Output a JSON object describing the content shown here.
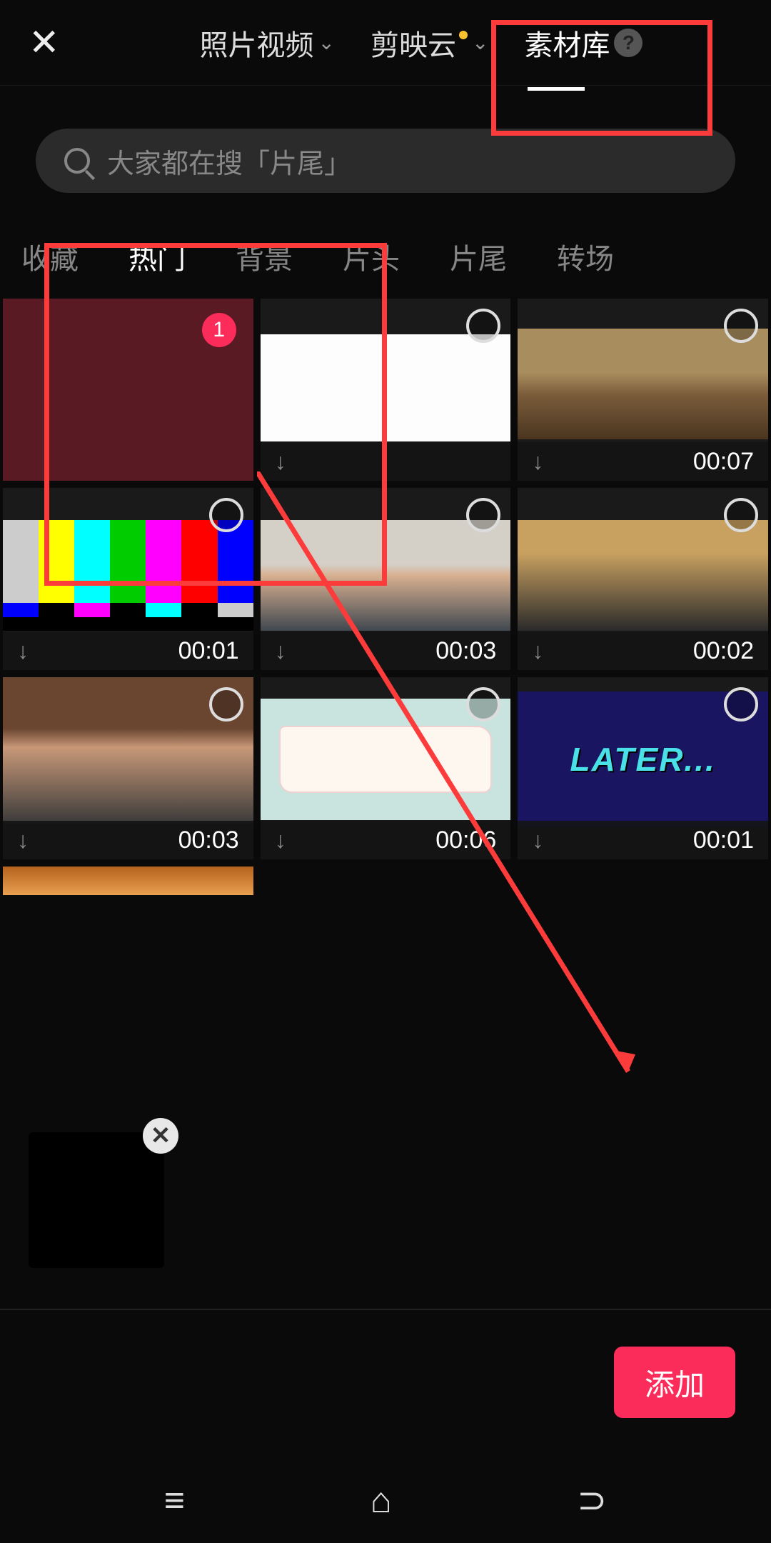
{
  "header": {
    "tabs": [
      {
        "label": "照片视频",
        "has_chevron": true
      },
      {
        "label": "剪映云",
        "has_chevron": true,
        "has_dot": true
      },
      {
        "label": "素材库",
        "has_help": true,
        "active": true
      }
    ]
  },
  "search": {
    "placeholder": "大家都在搜「片尾」"
  },
  "categories": {
    "items": [
      {
        "label": "收藏"
      },
      {
        "label": "热门",
        "active": true
      },
      {
        "label": "背景"
      },
      {
        "label": "片头"
      },
      {
        "label": "片尾"
      },
      {
        "label": "转场"
      }
    ]
  },
  "grid": {
    "cells": [
      {
        "selected_num": "1",
        "duration": null
      },
      {
        "duration": null
      },
      {
        "duration": "00:07"
      },
      {
        "duration": "00:01"
      },
      {
        "duration": "00:03"
      },
      {
        "duration": "00:02"
      },
      {
        "duration": "00:03"
      },
      {
        "duration": "00:06"
      },
      {
        "duration": "00:01"
      }
    ]
  },
  "later_text": "LATER...",
  "add_button": {
    "label": "添加"
  },
  "help_icon": "?"
}
